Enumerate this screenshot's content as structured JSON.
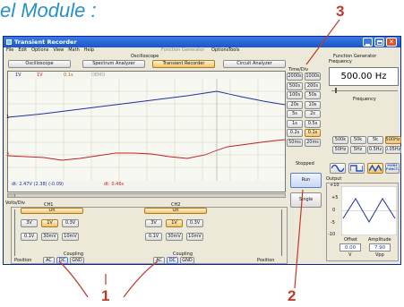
{
  "header": {
    "partial_title": "el Module :"
  },
  "window": {
    "title": "Transient Recorder",
    "menu": [
      "File",
      "Edit",
      "Options",
      "View",
      "Math",
      "Help"
    ],
    "menu_right": [
      "Function Generator",
      "Options",
      "Tools"
    ],
    "oscilloscope_label": "Oscilloscope",
    "tabs": [
      "Oscilloscope",
      "Spectrum Analyzer",
      "Transient Recorder",
      "Circuit Analyzer"
    ],
    "active_tab": 2
  },
  "scope": {
    "top_labels": [
      "1V",
      "1V",
      "0.1s",
      "DEMO"
    ],
    "status_left": "dt: 2.47V (2.38) (-0.09)",
    "status_right": "dt: 0.46s",
    "marker_1": "1",
    "marker_2": "2"
  },
  "timediv": {
    "label": "Time/Div",
    "buttons": [
      [
        "2000s",
        "1000s"
      ],
      [
        "500s",
        "200s"
      ],
      [
        "100s",
        "50s"
      ],
      [
        "20s",
        "10s"
      ],
      [
        "5s",
        "2s"
      ],
      [
        "1s",
        "0.5s"
      ],
      [
        "0.2s",
        "0.1s"
      ],
      [
        "50ms",
        "20ms"
      ]
    ],
    "selected": "0.1s",
    "status": "Stopped",
    "run_label": "Run",
    "single_label": "Single"
  },
  "volts": {
    "label": "Volts/Div",
    "ch1": {
      "name": "CH1",
      "on_label": "On",
      "buttons": [
        [
          "3V",
          "1V",
          "0.3V"
        ],
        [
          "0.1V",
          "30mV",
          "10mV"
        ]
      ],
      "selected": "1V",
      "coupling_label": "Coupling",
      "coupling": [
        "AC",
        "DC",
        "GND"
      ],
      "coupling_selected": "DC"
    },
    "ch2": {
      "name": "CH2",
      "on_label": "On",
      "buttons": [
        [
          "3V",
          "1V",
          "0.3V"
        ],
        [
          "0.1V",
          "30mV",
          "10mV"
        ]
      ],
      "selected": "1V",
      "coupling_label": "Coupling",
      "coupling": [
        "AC",
        "DC",
        "GND"
      ],
      "coupling_selected": "DC"
    },
    "position_label": "Position"
  },
  "fgen": {
    "title": "Function Generator",
    "frequency_label": "Frequency",
    "frequency_value": "500.00 Hz",
    "slider_label": "Frequency",
    "range_buttons": [
      [
        "500k",
        "50k",
        "5k",
        "500Hz"
      ],
      [
        "50Hz",
        "5Hz",
        "0.5Hz",
        "0.05Hz"
      ]
    ],
    "selected_range": "500Hz",
    "waveforms": [
      "sine",
      "square",
      "triangle"
    ],
    "selected_waveform": "triangle",
    "more_label": "MORE FUNCT.",
    "output_label": "Output",
    "y_ticks": [
      "+10",
      "+5",
      "0",
      "-5",
      "-10"
    ],
    "offset_label": "Offset",
    "offset_value": "0.00",
    "offset_unit": "V",
    "amplitude_label": "Amplitude",
    "amplitude_value": "7.90",
    "amplitude_unit": "Vpp"
  },
  "callouts": {
    "c1": "1",
    "c2": "2",
    "c3": "3"
  },
  "colors": {
    "ch1": "#2030a0",
    "ch2": "#c02020",
    "callout": "#c0392b",
    "titlebar": "#1a55c8"
  }
}
